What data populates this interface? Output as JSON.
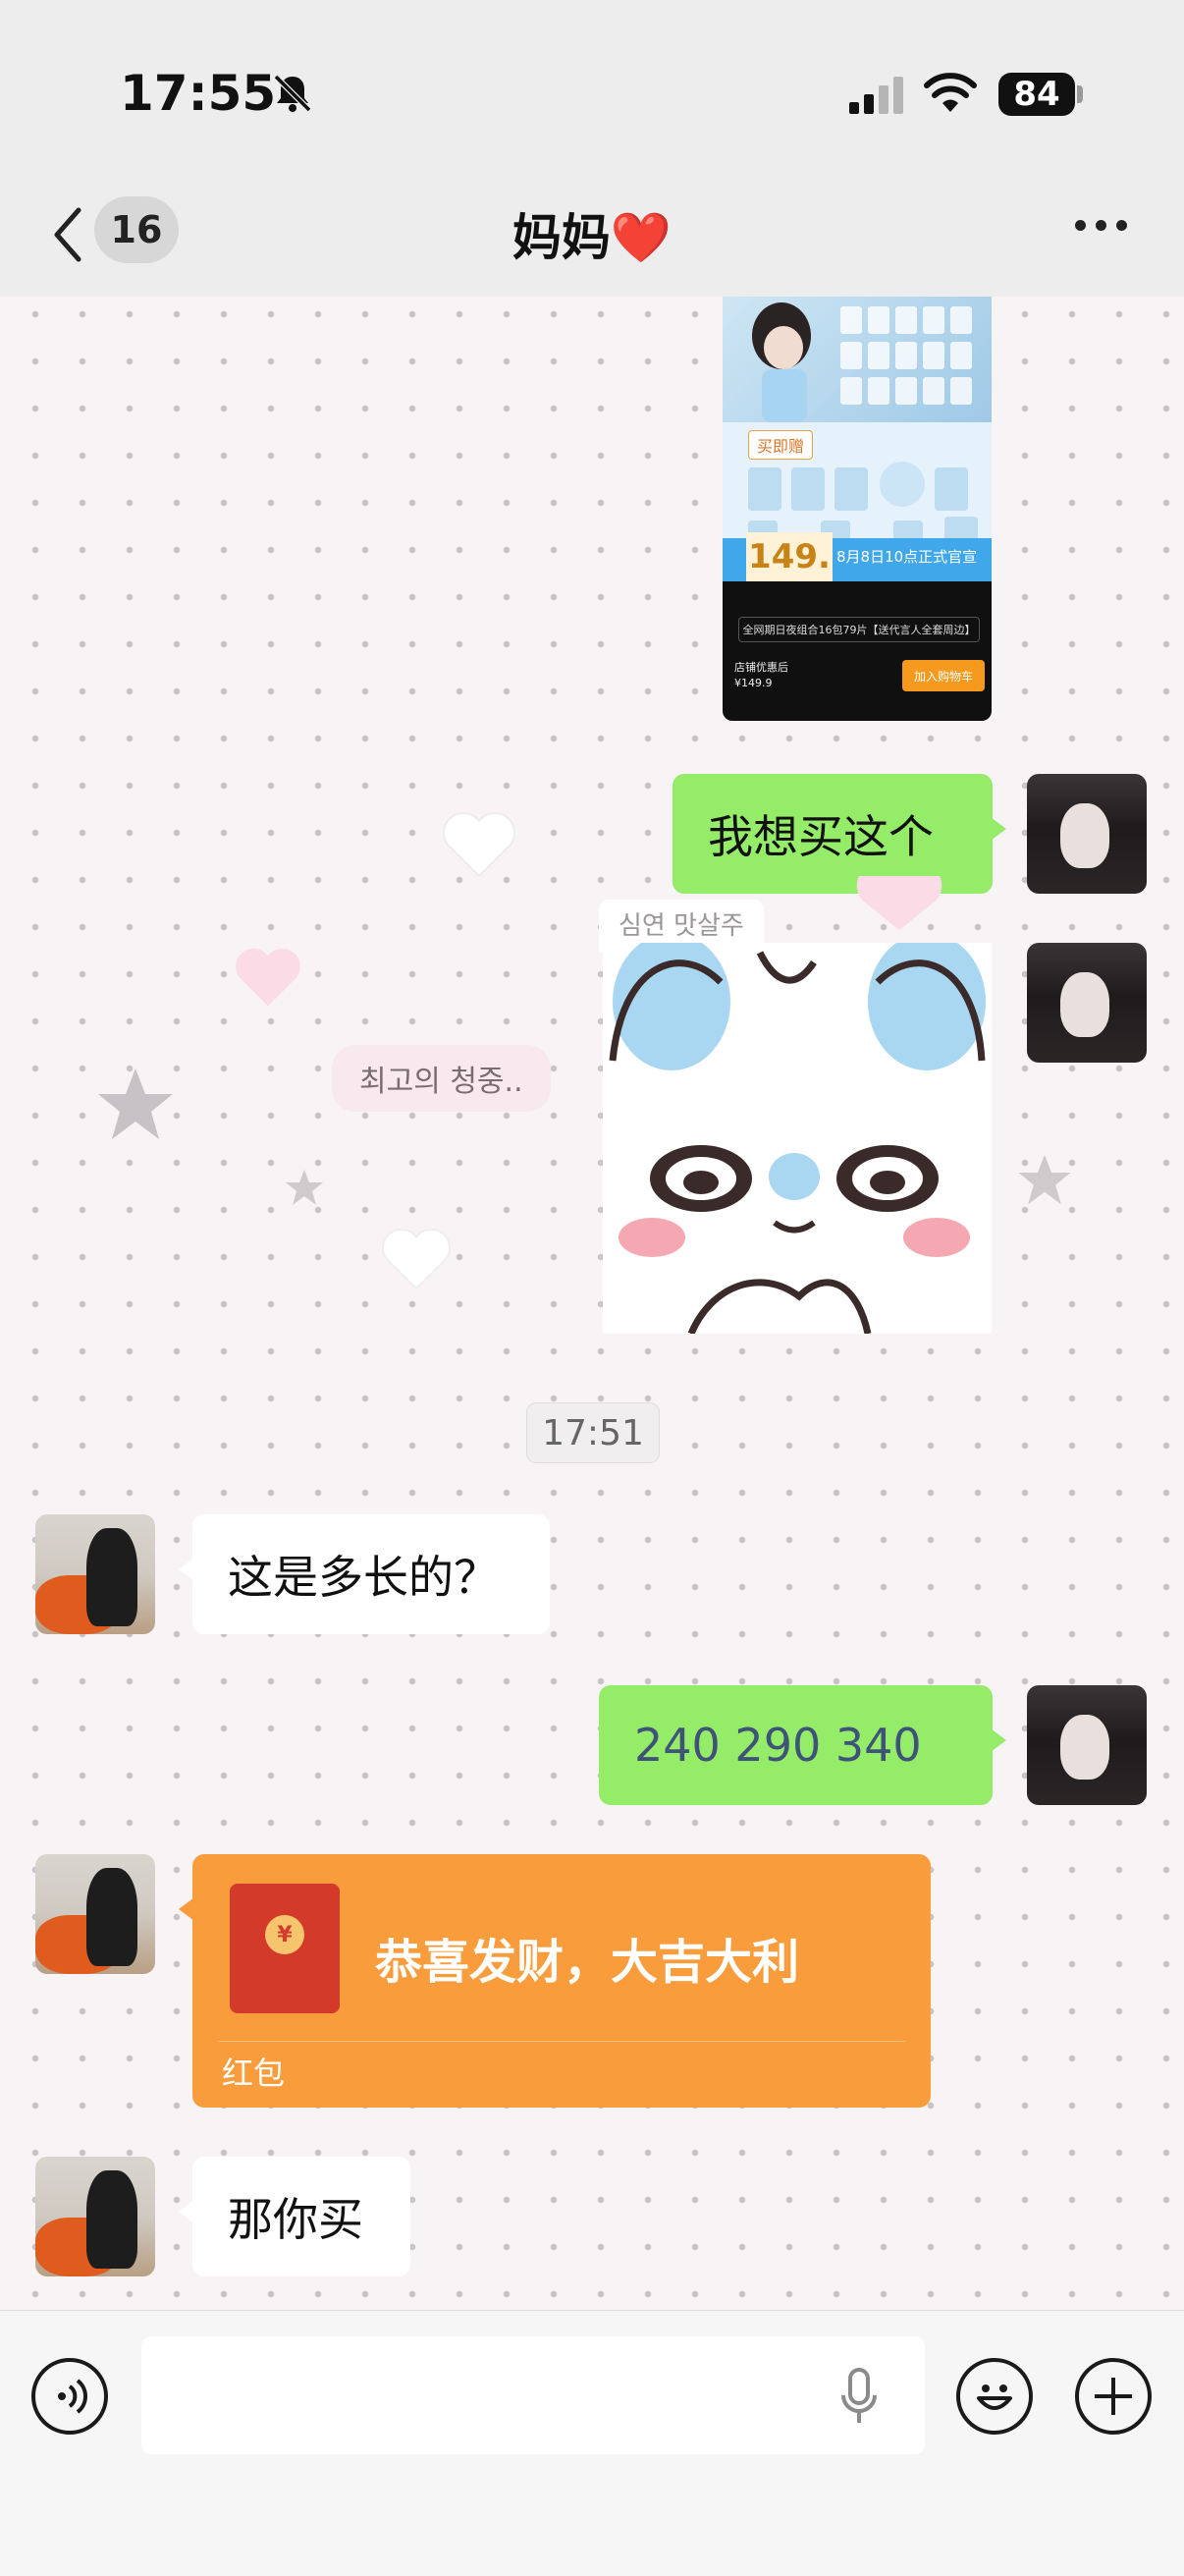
{
  "status_bar": {
    "time": "17:55",
    "battery": "84",
    "icons": [
      "bell-muted-icon",
      "cellular-signal-icon",
      "wifi-icon",
      "battery-icon"
    ]
  },
  "header": {
    "unread_count": "16",
    "title": "妈妈❤️",
    "back_icon": "chevron-left-icon",
    "more_icon": "more-horizontal-icon"
  },
  "messages": {
    "product_card": {
      "gift_tag": "买即赠",
      "price": "149.",
      "date_text": "8月8日10点正式官宣",
      "promo_line": "全网期日夜组合16包79片【送代言人全套周边】",
      "store_text": "店铺优惠后",
      "store_price": "¥149.9",
      "cart_button": "加入购物车"
    },
    "msg_want": "我想买这个",
    "deco_text_1": "최고의 청중..",
    "sticker_note": "심연 맛살주",
    "timestamp": "17:51",
    "msg_question": "这是多长的？",
    "msg_sizes": "240 290 340",
    "red_packet": {
      "title": "恭喜发财，大吉大利",
      "label": "红包",
      "coin": "¥"
    },
    "msg_buy": "那你买"
  },
  "input_bar": {
    "voice_icon": "voice-icon",
    "mic_icon": "microphone-icon",
    "emoji_icon": "emoji-icon",
    "plus_icon": "plus-icon",
    "placeholder": ""
  },
  "colors": {
    "sent_bubble": "#95ec69",
    "received_bubble": "#ffffff",
    "red_packet": "#f89c3c",
    "header_bg": "#ededed"
  }
}
